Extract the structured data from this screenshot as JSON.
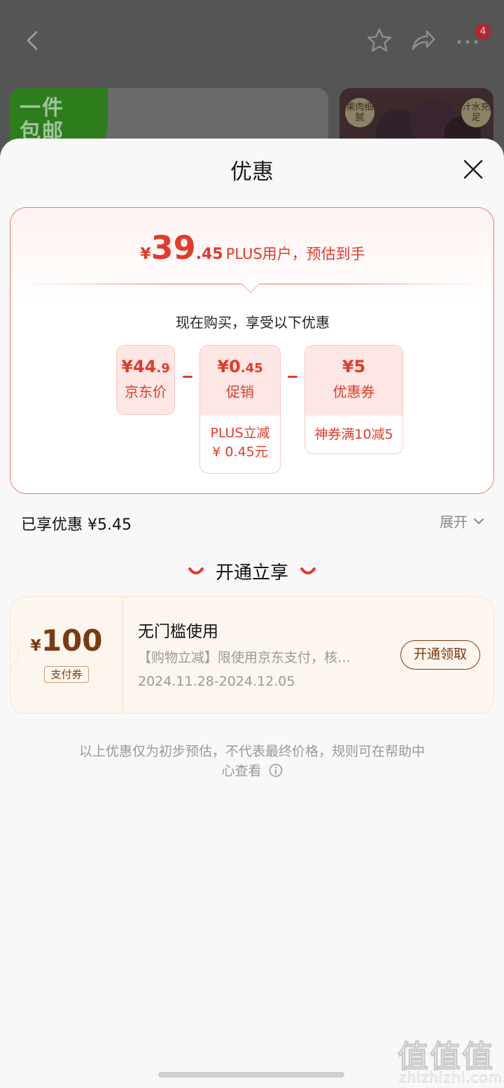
{
  "background": {
    "cart_badge": "4",
    "promo_banner_text": "一件包邮",
    "fruit_tags": [
      "果肉细腻",
      "汁水充足"
    ]
  },
  "sheet": {
    "title": "优惠",
    "estimate": {
      "currency": "¥",
      "integer": "39",
      "decimal": ".45",
      "label": "PLUS用户，预估到手"
    },
    "now_buy_text": "现在购买，享受以下优惠",
    "breakdown": [
      {
        "price_main": "¥44",
        "price_small": ".9",
        "name": "京东价",
        "detail": []
      },
      {
        "price_main": "¥0",
        "price_small": ".45",
        "name": "促销",
        "detail": [
          "PLUS立减",
          "¥ 0.45元"
        ]
      },
      {
        "price_main": "¥5",
        "price_small": "",
        "name": "优惠券",
        "detail": [
          "神券满10减5"
        ]
      }
    ],
    "enjoyed_text": "已享优惠 ¥5.45",
    "expand_label": "展开",
    "open_section_title": "开通立享",
    "coupon": {
      "currency": "¥",
      "amount": "100",
      "type_tag": "支付券",
      "title": "无门槛使用",
      "description": "【购物立减】限使用京东支付，核…",
      "validity": "2024.11.28-2024.12.05",
      "action_label": "开通领取"
    },
    "disclaimer_line1": "以上优惠仅为初步预估，不代表最终价格，规则可在帮助中",
    "disclaimer_line2": "心查看"
  },
  "watermark": {
    "glyphs": "值值值",
    "url": "zhizhizhi.com"
  },
  "colors": {
    "accent_red": "#e4392b",
    "coupon_brown": "#7a3b12",
    "muted_text": "#999999"
  }
}
